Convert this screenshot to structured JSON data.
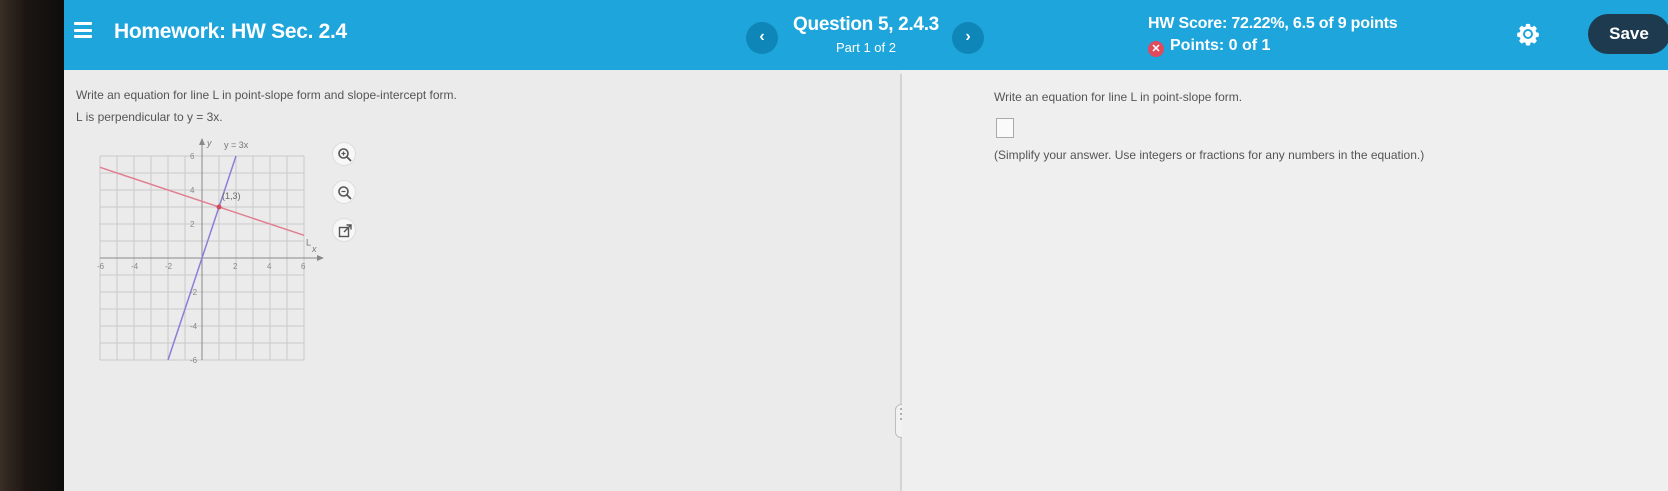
{
  "header": {
    "title": "Homework: HW Sec. 2.4",
    "question": "Question 5, 2.4.3",
    "part": "Part 1 of 2",
    "score": "HW Score: 72.22%, 6.5 of 9 points",
    "points": "Points: 0 of 1",
    "save_label": "Save",
    "prev_label": "‹",
    "next_label": "›",
    "points_badge": "✕"
  },
  "left": {
    "prompt": "Write an equation for line L in point-slope form and slope-intercept form.",
    "given": "L is perpendicular to y = 3x."
  },
  "graph": {
    "y_axis_label": "y",
    "x_axis_label": "x",
    "line1_label": "y = 3x",
    "line2_label": "L",
    "point_label": "(1,3)",
    "point": [
      1,
      3
    ],
    "x_ticks": [
      "-6",
      "-4",
      "-2",
      "2",
      "4",
      "6"
    ],
    "y_ticks": [
      "6",
      "4",
      "2",
      "-2",
      "-4",
      "-6"
    ],
    "xlim": [
      -6,
      6
    ],
    "ylim": [
      -6,
      6
    ],
    "line1_color": "#8a7fd6",
    "line2_color": "#e08090"
  },
  "right": {
    "prompt": "Write an equation for line L in point-slope form.",
    "hint": "(Simplify your answer. Use integers or fractions for any numbers in the equation.)"
  },
  "colors": {
    "header_bg": "#1ea6dc",
    "save_bg": "#1d3a4f",
    "incorrect": "#e14a5a"
  }
}
